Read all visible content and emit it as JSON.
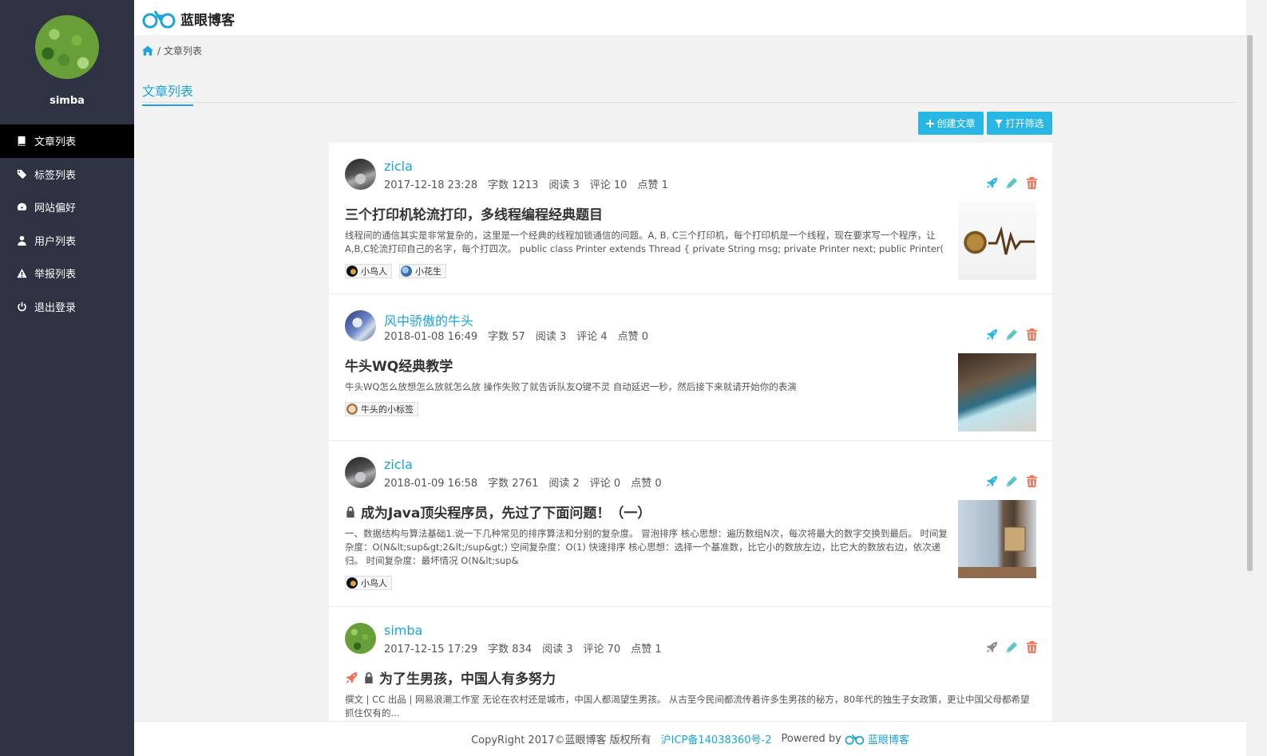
{
  "sidebar": {
    "username": "simba",
    "items": [
      {
        "label": "文章列表",
        "icon": "book-icon",
        "active": true
      },
      {
        "label": "标签列表",
        "icon": "tags-icon"
      },
      {
        "label": "网站偏好",
        "icon": "dashboard-icon"
      },
      {
        "label": "用户列表",
        "icon": "user-icon"
      },
      {
        "label": "举报列表",
        "icon": "warning-icon"
      },
      {
        "label": "退出登录",
        "icon": "power-icon"
      }
    ]
  },
  "header": {
    "brand": "蓝眼博客"
  },
  "breadcrumb": {
    "separator": "/",
    "current": "文章列表"
  },
  "tabs": [
    {
      "label": "文章列表"
    }
  ],
  "toolbar": {
    "create_label": "创建文章",
    "filter_label": "打开筛选"
  },
  "colors": {
    "accent": "#1aa4da",
    "button": "#29b6e5",
    "sidebar": "#2f3242",
    "delete": "#f0745a"
  },
  "articles": [
    {
      "author": "zicla",
      "date": "2017-12-18 23:28",
      "words": "字数 1213",
      "reads": "阅读 3",
      "comments": "评论 10",
      "likes": "点赞 1",
      "title": "三个打印机轮流打印，多线程编程经典题目",
      "excerpt": "线程间的通信其实是非常复杂的，这里是一个经典的线程加锁通信的问题。A, B, C三个打印机，每个打印机是一个线程，现在要求写一个程序，让A,B,C轮流打印自己的名字，每个打四次。 public class Printer extends Thread { private String msg; private Printer next; public Printer(",
      "tags": [
        "小鸟人",
        "小花生"
      ]
    },
    {
      "author": "风中骄傲的牛头",
      "date": "2018-01-08 16:49",
      "words": "字数 57",
      "reads": "阅读 3",
      "comments": "评论 4",
      "likes": "点赞 0",
      "title": "牛头WQ经典教学",
      "excerpt": "牛头WQ怎么放想怎么放就怎么放 操作失败了就告诉队友Q键不灵 自动延迟一秒，然后接下来就请开始你的表演",
      "tags": [
        "牛头的小标签"
      ]
    },
    {
      "author": "zicla",
      "date": "2018-01-09 16:58",
      "words": "字数 2761",
      "reads": "阅读 2",
      "comments": "评论 0",
      "likes": "点赞 0",
      "title": "成为Java顶尖程序员，先过了下面问题！（一）",
      "excerpt": "一、数据结构与算法基础1.说一下几种常见的排序算法和分别的复杂度。 冒泡排序 核心思想：遍历数组N次，每次将最大的数字交换到最后。 时间复杂度：O(N&lt;sup&gt;2&lt;/sup&gt;) 空间复杂度：O(1) 快速排序 核心思想：选择一个基准数，比它小的数放左边，比它大的数放右边，依次递归。 时间复杂度：最坏情况 O(N&lt;sup&",
      "tags": [
        "小鸟人"
      ]
    },
    {
      "author": "simba",
      "date": "2017-12-15 17:29",
      "words": "字数 834",
      "reads": "阅读 3",
      "comments": "评论 70",
      "likes": "点赞 1",
      "title": "为了生男孩，中国人有多努力",
      "excerpt": "撰文 | CC 出品 | 网易浪潮工作室 无论在农村还是城市，中国人都渴望生男孩。 从古至今民间都流传着许多生男孩的秘方，80年代的独生子女政策，更让中国父母都希望抓住仅有的...",
      "tags": []
    }
  ],
  "footer": {
    "copyright": "CopyRight 2017©蓝眼博客 版权所有",
    "icp": "沪ICP备14038360号-2",
    "powered": "Powered by",
    "brand": "蓝眼博客"
  }
}
